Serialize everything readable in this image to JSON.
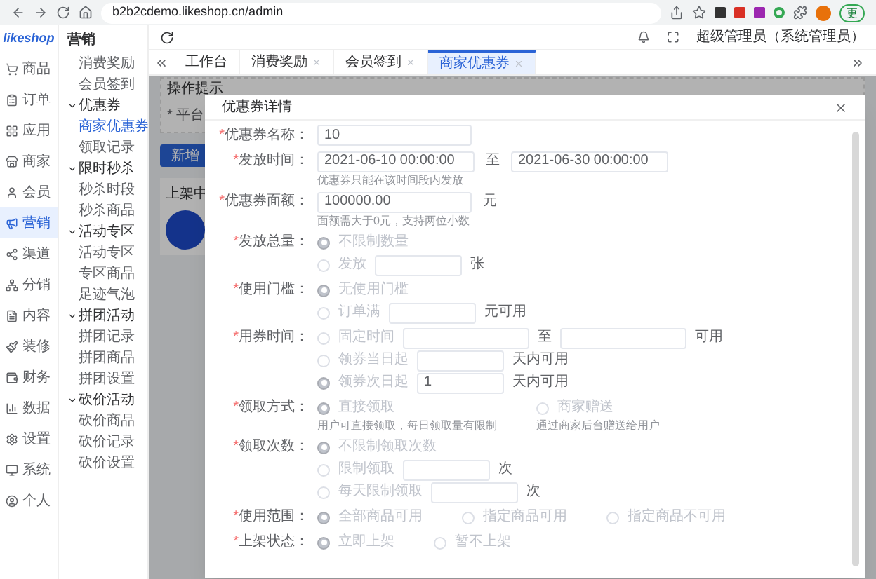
{
  "browser": {
    "url": "b2b2cdemo.likeshop.cn/admin",
    "update_label": "更"
  },
  "logo": "likeshop",
  "nav": [
    {
      "label": "商品",
      "selected": false
    },
    {
      "label": "订单",
      "selected": false
    },
    {
      "label": "应用",
      "selected": false
    },
    {
      "label": "商家",
      "selected": false
    },
    {
      "label": "会员",
      "selected": false
    },
    {
      "label": "营销",
      "selected": true
    },
    {
      "label": "渠道",
      "selected": false
    },
    {
      "label": "分销",
      "selected": false
    },
    {
      "label": "内容",
      "selected": false
    },
    {
      "label": "装修",
      "selected": false
    },
    {
      "label": "财务",
      "selected": false
    },
    {
      "label": "数据",
      "selected": false
    },
    {
      "label": "设置",
      "selected": false
    },
    {
      "label": "系统",
      "selected": false
    },
    {
      "label": "个人",
      "selected": false
    }
  ],
  "submenu": {
    "title": "营销",
    "items": [
      {
        "label": "消费奖励",
        "selected": false
      },
      {
        "label": "会员签到",
        "selected": false
      },
      {
        "label": "优惠券",
        "expanded": true,
        "children": [
          {
            "label": "商家优惠券",
            "selected": true
          },
          {
            "label": "领取记录",
            "selected": false
          }
        ]
      },
      {
        "label": "限时秒杀",
        "expanded": true,
        "children": [
          {
            "label": "秒杀时段",
            "selected": false
          },
          {
            "label": "秒杀商品",
            "selected": false
          }
        ]
      },
      {
        "label": "活动专区",
        "expanded": true,
        "children": [
          {
            "label": "活动专区",
            "selected": false
          },
          {
            "label": "专区商品",
            "selected": false
          },
          {
            "label": "足迹气泡",
            "selected": false
          }
        ]
      },
      {
        "label": "拼团活动",
        "expanded": true,
        "children": [
          {
            "label": "拼团记录",
            "selected": false
          },
          {
            "label": "拼团商品",
            "selected": false
          },
          {
            "label": "拼团设置",
            "selected": false
          }
        ]
      },
      {
        "label": "砍价活动",
        "expanded": true,
        "children": [
          {
            "label": "砍价商品",
            "selected": false
          },
          {
            "label": "砍价记录",
            "selected": false
          },
          {
            "label": "砍价设置",
            "selected": false
          }
        ]
      }
    ]
  },
  "header": {
    "user": "超级管理员（系统管理员）"
  },
  "tabs": [
    {
      "label": "工作台",
      "selected": false,
      "closable": false
    },
    {
      "label": "消费奖励",
      "selected": false,
      "closable": true
    },
    {
      "label": "会员签到",
      "selected": false,
      "closable": true
    },
    {
      "label": "商家优惠券",
      "selected": true,
      "closable": true
    }
  ],
  "background": {
    "tips_title": "操作提示",
    "tip": "* 平台",
    "add_button": "新增",
    "section_title": "上架中"
  },
  "modal": {
    "title": "优惠券详情",
    "fields": [
      {
        "kind": "input",
        "required_mark": "*",
        "label": "优惠券名称：",
        "value": "10"
      },
      {
        "kind": "range",
        "required_mark": "*",
        "label": "发放时间：",
        "from": "2021-06-10 00:00:00",
        "separator": "至",
        "to": "2021-06-30 00:00:00",
        "hint": "优惠券只能在该时间段内发放"
      },
      {
        "kind": "input",
        "required_mark": "*",
        "label": "优惠券面额：",
        "value": "100000.00",
        "unit": "元",
        "hint": "面额需大于0元，支持两位小数"
      },
      {
        "kind": "options",
        "required_mark": "*",
        "label": "发放总量：",
        "horizontal": false,
        "options": [
          {
            "kind": "plain",
            "label": "不限制数量",
            "selected": true
          },
          {
            "kind": "input",
            "label": "发放",
            "selected": false,
            "unit": "张"
          }
        ]
      },
      {
        "kind": "options",
        "required_mark": "*",
        "label": "使用门槛：",
        "horizontal": false,
        "options": [
          {
            "kind": "plain",
            "label": "无使用门槛",
            "selected": true
          },
          {
            "kind": "input",
            "label": "订单满",
            "selected": false,
            "unit": "元可用"
          }
        ]
      },
      {
        "kind": "options",
        "required_mark": "*",
        "label": "用券时间：",
        "horizontal": false,
        "options": [
          {
            "kind": "range",
            "label": "固定时间",
            "selected": false,
            "separator": "至",
            "unit": "可用"
          },
          {
            "kind": "input",
            "label": "领券当日起",
            "selected": false,
            "unit": "天内可用"
          },
          {
            "kind": "input",
            "label": "领券次日起",
            "selected": true,
            "value": "1",
            "unit": "天内可用"
          }
        ]
      },
      {
        "kind": "options",
        "required_mark": "*",
        "label": "领取方式：",
        "horizontal": true,
        "options": [
          {
            "kind": "plain",
            "label": "直接领取",
            "selected": true,
            "hint": "用户可直接领取，每日领取量有限制"
          },
          {
            "kind": "plain",
            "label": "商家赠送",
            "selected": false,
            "hint": "通过商家后台赠送给用户"
          }
        ]
      },
      {
        "kind": "options",
        "required_mark": "*",
        "label": "领取次数：",
        "horizontal": false,
        "options": [
          {
            "kind": "plain",
            "label": "不限制领取次数",
            "selected": true
          },
          {
            "kind": "input",
            "label": "限制领取",
            "selected": false,
            "unit": "次"
          },
          {
            "kind": "input",
            "label": "每天限制领取",
            "selected": false,
            "unit": "次"
          }
        ]
      },
      {
        "kind": "options",
        "required_mark": "*",
        "label": "使用范围：",
        "horizontal": true,
        "options": [
          {
            "kind": "plain",
            "label": "全部商品可用",
            "selected": true
          },
          {
            "kind": "plain",
            "label": "指定商品可用",
            "selected": false
          },
          {
            "kind": "plain",
            "label": "指定商品不可用",
            "selected": false
          }
        ]
      },
      {
        "kind": "options",
        "required_mark": "*",
        "label": "上架状态：",
        "horizontal": true,
        "options": [
          {
            "kind": "plain",
            "label": "立即上架",
            "selected": true
          },
          {
            "kind": "plain",
            "label": "暂不上架",
            "selected": false
          }
        ]
      }
    ]
  }
}
